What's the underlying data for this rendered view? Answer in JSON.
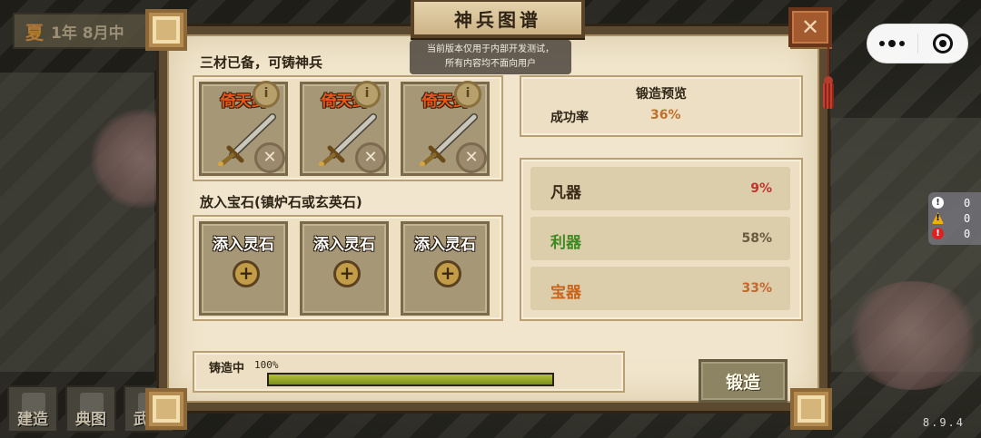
{
  "hud": {
    "season": "夏",
    "date": "1年 8月中"
  },
  "dialog": {
    "title": "神兵图谱",
    "close_label": "✕",
    "notice_line1": "当前版本仅用于内部开发测试，",
    "notice_line2": "所有内容均不面向用户"
  },
  "materials": {
    "heading": "三材已备，可铸神兵",
    "slots": [
      {
        "name": "倚天剑",
        "info": "i",
        "remove": "✕"
      },
      {
        "name": "倚天剑",
        "info": "i",
        "remove": "✕"
      },
      {
        "name": "倚天剑",
        "info": "i",
        "remove": "✕"
      }
    ]
  },
  "gems": {
    "heading": "放入宝石(镇炉石或玄英石)",
    "slots": [
      {
        "label": "添入灵石",
        "add": "+"
      },
      {
        "label": "添入灵石",
        "add": "+"
      },
      {
        "label": "添入灵石",
        "add": "+"
      }
    ]
  },
  "preview": {
    "title": "锻造预览",
    "success_label": "成功率",
    "success_value": "36%"
  },
  "tiers": [
    {
      "name": "凡器",
      "value": "9%",
      "name_color": "#3a2c18",
      "value_color": "#c0342c"
    },
    {
      "name": "利器",
      "value": "58%",
      "name_color": "#3e8a22",
      "value_color": "#6a5a40"
    },
    {
      "name": "宝器",
      "value": "33%",
      "name_color": "#c8641c",
      "value_color": "#c06a30"
    }
  ],
  "progress": {
    "label": "铸造中",
    "percent_text": "100%",
    "fraction": 1.0
  },
  "forge_button": "锻造",
  "bottom_nav": [
    {
      "label": "建造",
      "icon": "hammer-icon"
    },
    {
      "label": "典图",
      "icon": "book-icon"
    },
    {
      "label": "武器",
      "icon": "weapon-icon"
    }
  ],
  "debug": {
    "info_count": "0",
    "warn_count": "0",
    "error_count": "0"
  },
  "version": "8.9.4"
}
